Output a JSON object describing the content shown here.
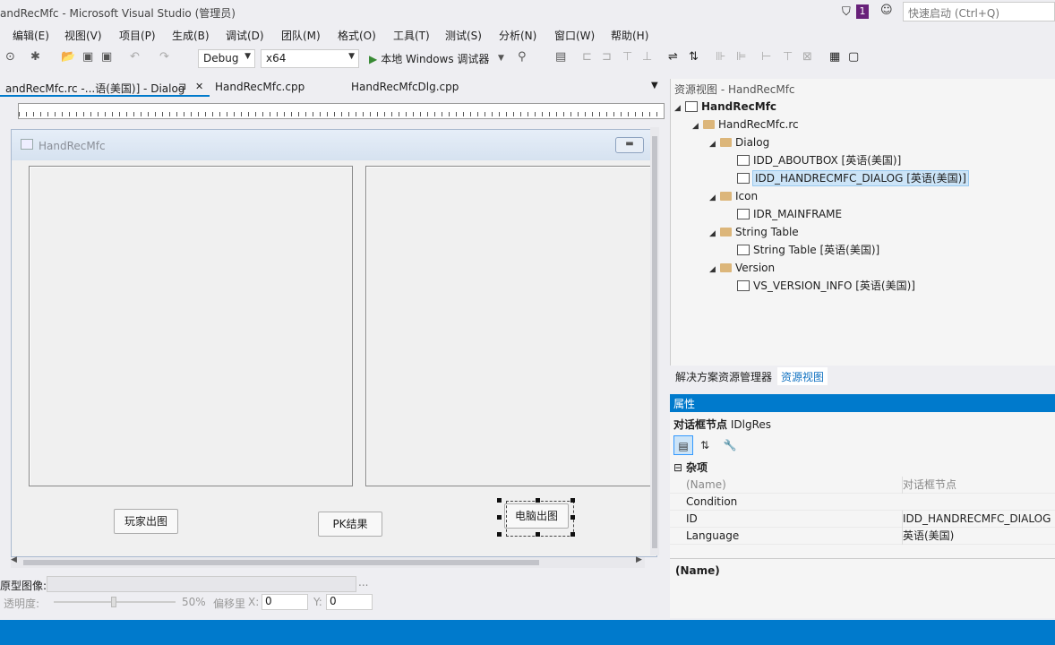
{
  "window": {
    "title": "andRecMfc - Microsoft Visual Studio (管理员)",
    "notifications_count": "1",
    "quick_launch_placeholder": "快速启动 (Ctrl+Q)"
  },
  "menu": [
    "编辑(E)",
    "视图(V)",
    "项目(P)",
    "生成(B)",
    "调试(D)",
    "团队(M)",
    "格式(O)",
    "工具(T)",
    "测试(S)",
    "分析(N)",
    "窗口(W)",
    "帮助(H)"
  ],
  "toolbar": {
    "config": "Debug",
    "platform": "x64",
    "run_label": "本地 Windows 调试器"
  },
  "doc_tabs": [
    {
      "label": "andRecMfc.rc -...语(美国)] - Dialog",
      "pin": "⊐",
      "close": "✕"
    },
    {
      "label": "HandRecMfc.cpp"
    },
    {
      "label": "HandRecMfcDlg.cpp"
    }
  ],
  "dialog": {
    "title": "HandRecMfc",
    "buttons": {
      "player": "玩家出图",
      "pk": "PK结果",
      "computer": "电脑出图"
    }
  },
  "bottom_panel": {
    "image_label": "原型图像:",
    "browse": "...",
    "opacity_label": "透明度:",
    "opacity_value": "50%",
    "offset_label": "偏移里",
    "x_label": "X:",
    "x_value": "0",
    "y_label": "Y:",
    "y_value": "0"
  },
  "resource_view": {
    "header": "资源视图 - HandRecMfc",
    "project": "HandRecMfc",
    "rc_file": "HandRecMfc.rc",
    "folders": {
      "dialog": "Dialog",
      "icon": "Icon",
      "string_table": "String Table",
      "version": "Version"
    },
    "items": {
      "aboutbox": "IDD_ABOUTBOX [英语(美国)]",
      "main_dialog": "IDD_HANDRECMFC_DIALOG [英语(美国)]",
      "mainframe": "IDR_MAINFRAME",
      "string_table": "String Table [英语(美国)]",
      "version_info": "VS_VERSION_INFO [英语(美国)]"
    }
  },
  "panel_tabs": [
    "解决方案资源管理器",
    "资源视图"
  ],
  "properties": {
    "header": "属性",
    "object_label": "对话框节点",
    "object_type": "IDlgRes",
    "category": "杂项",
    "rows": [
      {
        "key": "(Name)",
        "value": "对话框节点"
      },
      {
        "key": "Condition",
        "value": ""
      },
      {
        "key": "ID",
        "value": "IDD_HANDRECMFC_DIALOG"
      },
      {
        "key": "Language",
        "value": "英语(美国)"
      }
    ],
    "description": "(Name)"
  },
  "colors": {
    "accent": "#007acc",
    "run_green": "#388a34",
    "notif_badge": "#68217a"
  }
}
